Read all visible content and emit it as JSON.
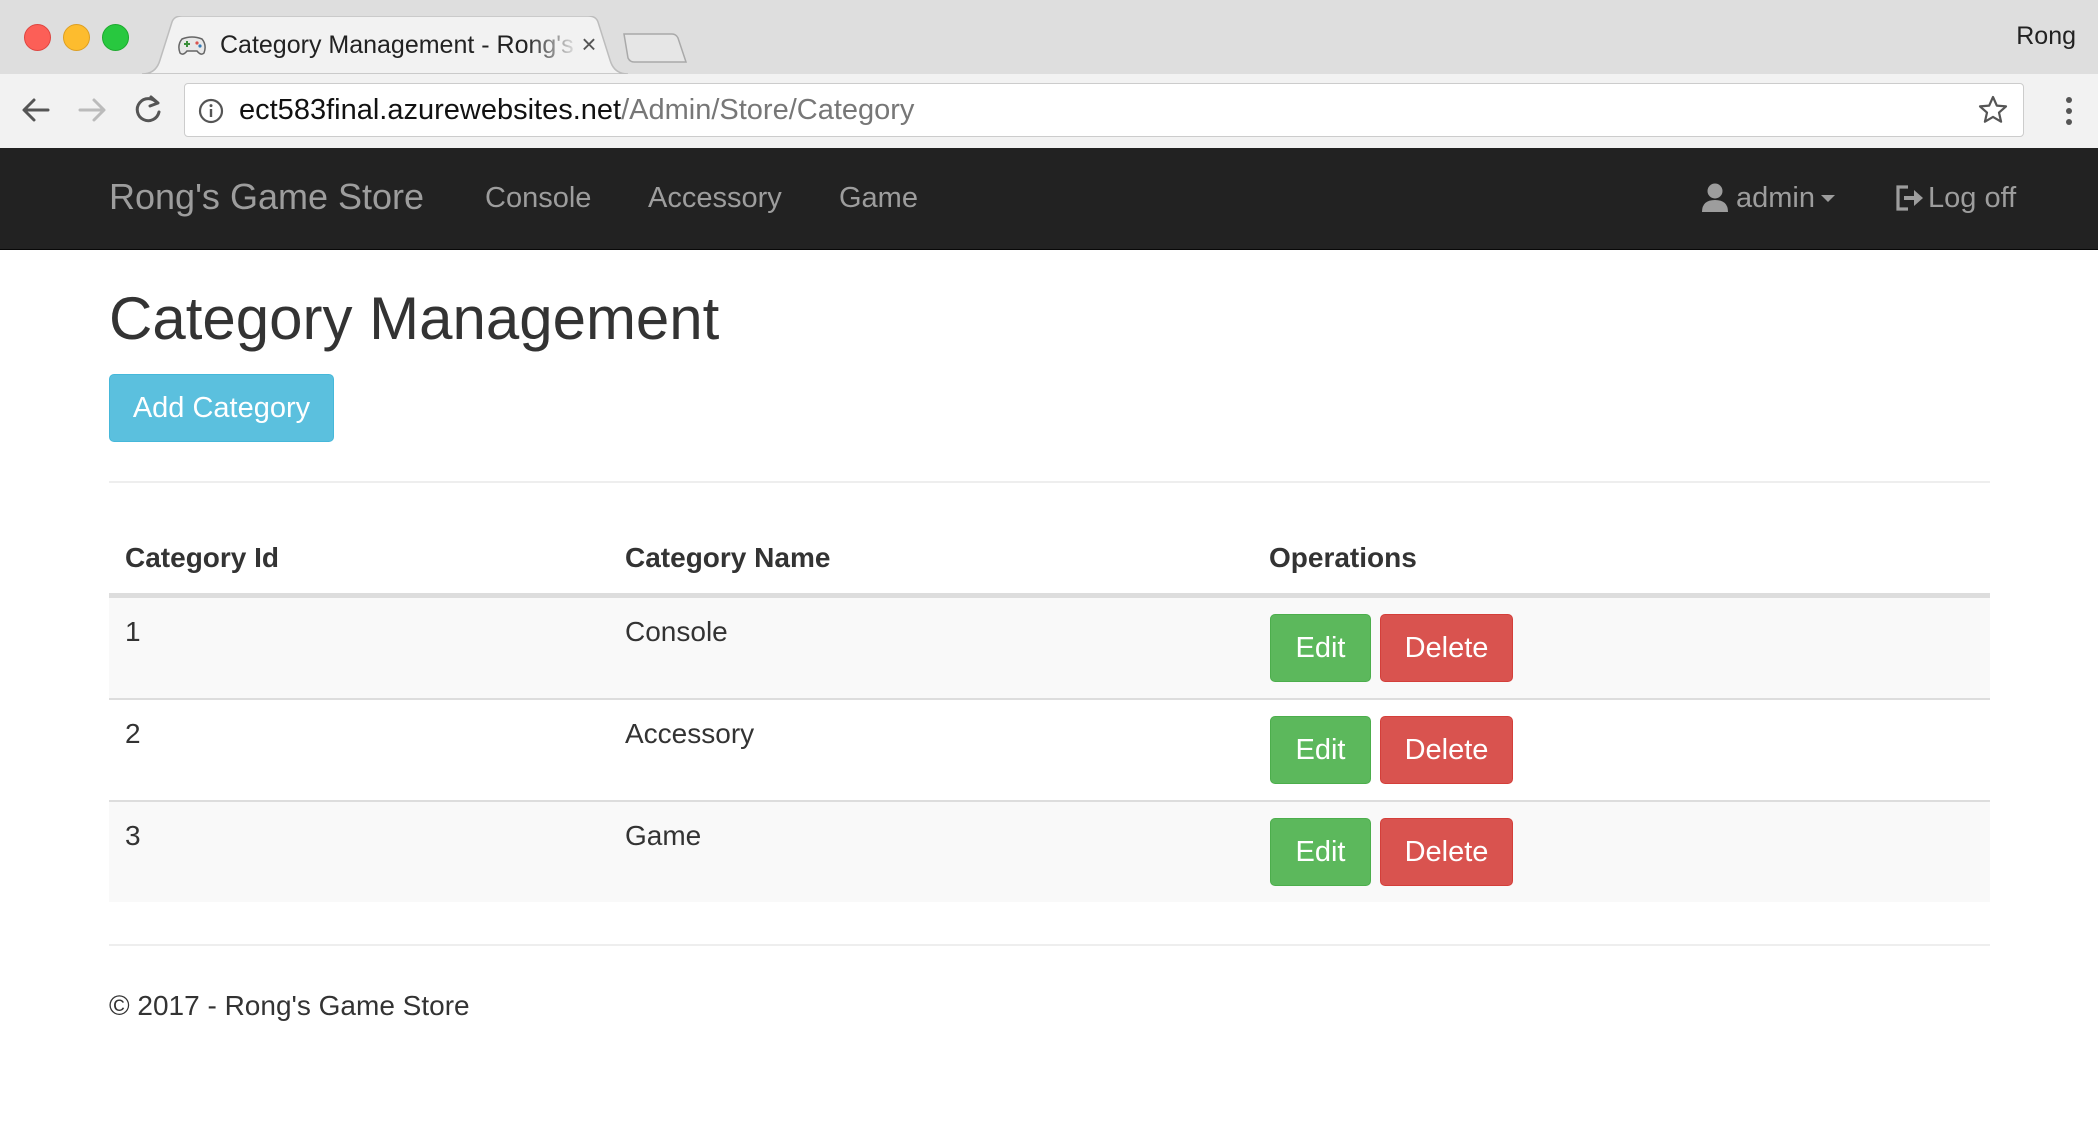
{
  "browser": {
    "tab_title": "Category Management - Rong's Game Store",
    "profile_name": "Rong",
    "url_host": "ect583final.azurewebsites.net",
    "url_path": "/Admin/Store/Category"
  },
  "navbar": {
    "brand": "Rong's Game Store",
    "links": [
      "Console",
      "Accessory",
      "Game"
    ],
    "user": "admin",
    "logoff": "Log off"
  },
  "page": {
    "title": "Category Management",
    "add_button": "Add Category"
  },
  "table": {
    "headers": [
      "Category Id",
      "Category Name",
      "Operations"
    ],
    "rows": [
      {
        "id": "1",
        "name": "Console",
        "edit": "Edit",
        "delete": "Delete"
      },
      {
        "id": "2",
        "name": "Accessory",
        "edit": "Edit",
        "delete": "Delete"
      },
      {
        "id": "3",
        "name": "Game",
        "edit": "Edit",
        "delete": "Delete"
      }
    ]
  },
  "footer": {
    "text": "© 2017 - Rong's Game Store"
  },
  "colors": {
    "navbar_bg": "#222222",
    "info": "#5bc0de",
    "success": "#5cb85c",
    "danger": "#d9534f"
  }
}
